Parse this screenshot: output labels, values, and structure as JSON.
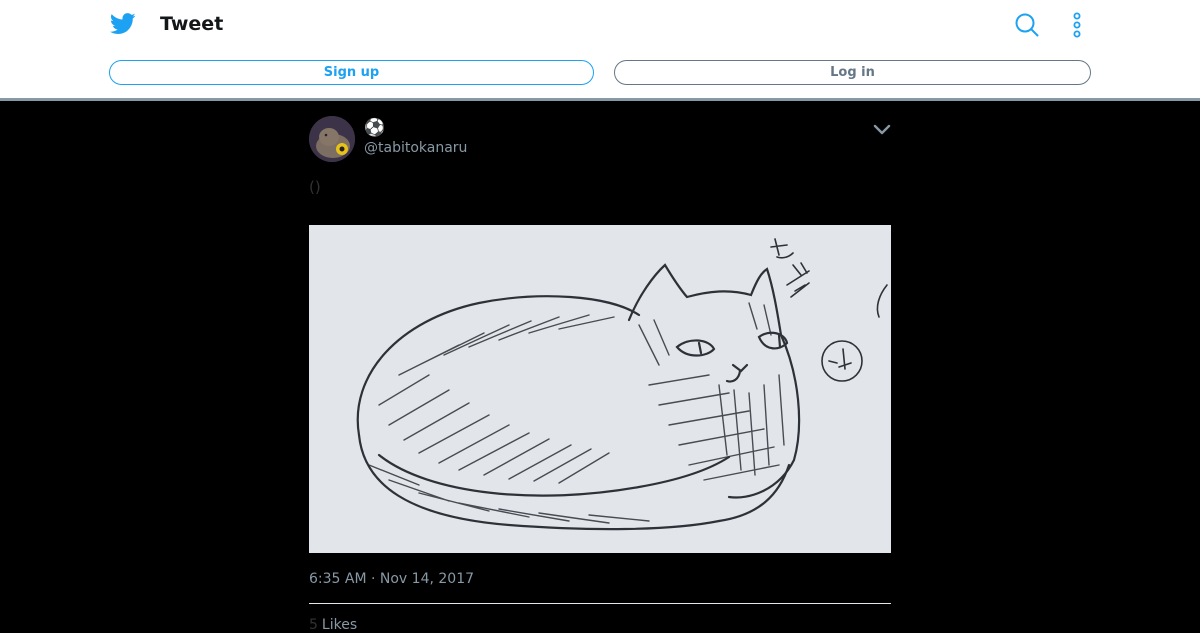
{
  "header": {
    "title": "Tweet",
    "logo_icon": "twitter-bird-icon",
    "search_icon": "search-icon",
    "more_icon": "more-vertical-icon",
    "signup_label": "Sign up",
    "login_label": "Log in",
    "accent": "#1da1f2"
  },
  "tweet": {
    "display_name": "⚽",
    "username": "@tabitokanaru",
    "text": "()",
    "timestamp": "6:35 AM · Nov 14, 2017",
    "likes_count": "5",
    "likes_label": "Likes"
  }
}
